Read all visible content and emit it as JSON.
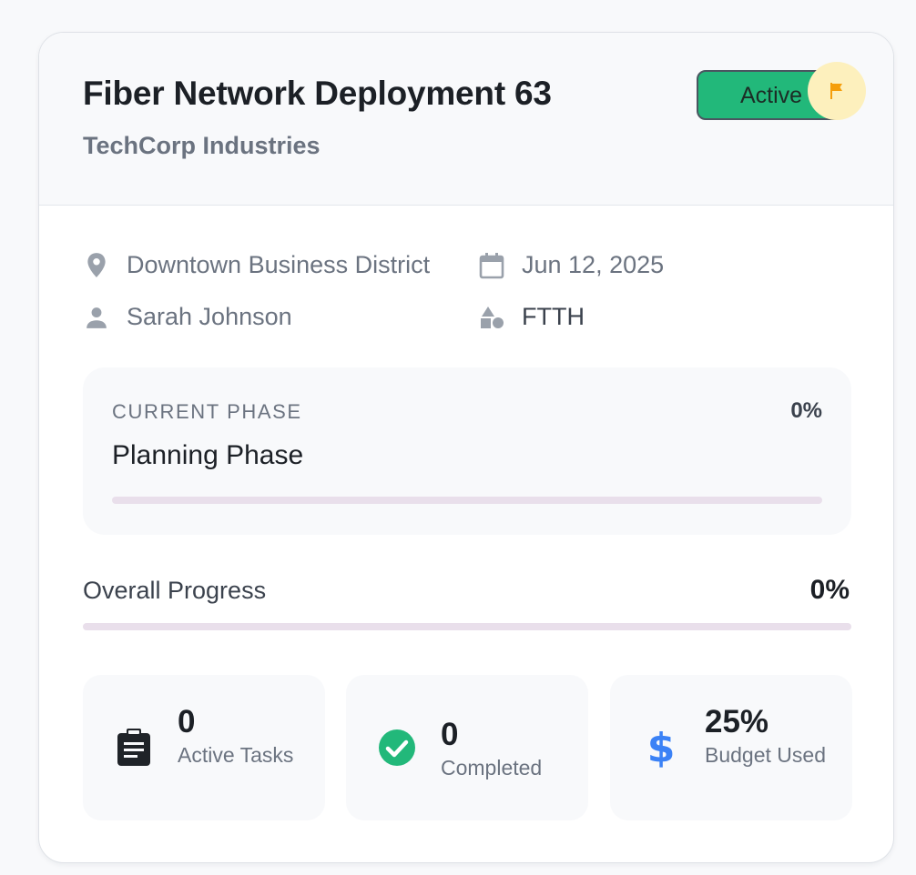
{
  "project": {
    "title": "Fiber Network Deployment 63",
    "client": "TechCorp Industries",
    "status": "Active",
    "status_color": "#22b87a",
    "flag_icon": "flag-icon",
    "flag_color": "#f59e0b"
  },
  "meta": {
    "location": "Downtown Business District",
    "date": "Jun 12, 2025",
    "manager": "Sarah Johnson",
    "type": "FTTH"
  },
  "phase": {
    "caption": "CURRENT PHASE",
    "name": "Planning Phase",
    "percent_label": "0%",
    "progress": 0
  },
  "overall": {
    "label": "Overall Progress",
    "percent_label": "0%",
    "progress": 0
  },
  "stats": [
    {
      "icon": "clipboard-icon",
      "value": "0",
      "label": "Active Tasks"
    },
    {
      "icon": "check-circle-icon",
      "value": "0",
      "label": "Completed",
      "color": "#22b87a"
    },
    {
      "icon": "dollar-icon",
      "value": "25%",
      "label": "Budget Used",
      "color": "#3b82f6"
    }
  ],
  "colors": {
    "progress_track": "#e9dfeb",
    "progress_fill": "#8a4fa6"
  }
}
